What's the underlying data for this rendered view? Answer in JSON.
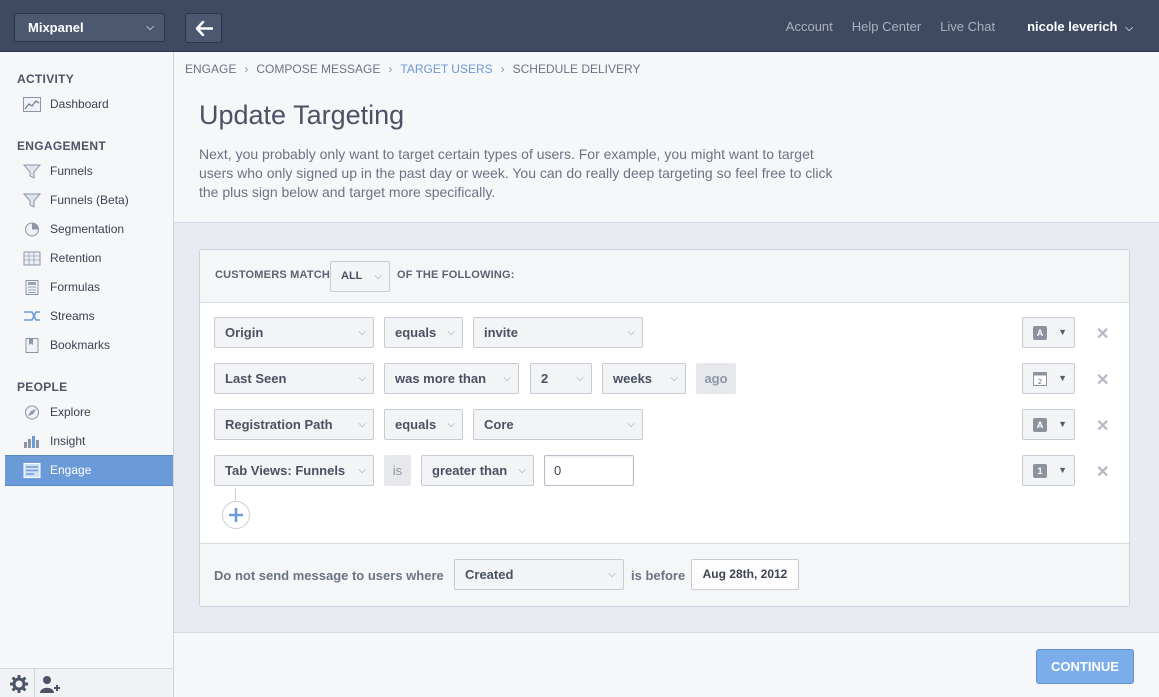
{
  "app": {
    "name": "Mixpanel"
  },
  "topbar": {
    "links": [
      "Account",
      "Help Center",
      "Live Chat"
    ],
    "user": "nicole leverich"
  },
  "sidebar": {
    "sections": [
      {
        "title": "ACTIVITY",
        "items": [
          {
            "label": "Dashboard",
            "icon": "dashboard-icon"
          }
        ]
      },
      {
        "title": "ENGAGEMENT",
        "items": [
          {
            "label": "Funnels",
            "icon": "funnel-icon"
          },
          {
            "label": "Funnels (Beta)",
            "icon": "funnel-icon"
          },
          {
            "label": "Segmentation",
            "icon": "pie-chart-icon"
          },
          {
            "label": "Retention",
            "icon": "retention-grid-icon"
          },
          {
            "label": "Formulas",
            "icon": "calculator-icon"
          },
          {
            "label": "Streams",
            "icon": "streams-icon"
          },
          {
            "label": "Bookmarks",
            "icon": "bookmark-icon"
          }
        ]
      },
      {
        "title": "PEOPLE",
        "items": [
          {
            "label": "Explore",
            "icon": "compass-icon"
          },
          {
            "label": "Insight",
            "icon": "bar-chart-icon"
          },
          {
            "label": "Engage",
            "icon": "engage-icon",
            "active": true
          }
        ]
      }
    ]
  },
  "breadcrumb": [
    "ENGAGE",
    "COMPOSE MESSAGE",
    "TARGET USERS",
    "SCHEDULE DELIVERY"
  ],
  "breadcrumb_current": 2,
  "page": {
    "title": "Update Targeting",
    "description": "Next, you probably only want to target certain types of users. For example, you might want to target users who only signed up in the past day or week. You can do really deep targeting so feel free to click the plus sign below and target more specifically."
  },
  "targeting": {
    "match_prefix": "CUSTOMERS MATCH",
    "match_value": "ALL",
    "match_suffix": "OF THE FOLLOWING:",
    "rules": [
      {
        "property": "Origin",
        "operator": "equals",
        "value": "invite",
        "type_badge": "A"
      },
      {
        "property": "Last Seen",
        "operator": "was more than",
        "value": "2",
        "unit": "weeks",
        "suffix": "ago",
        "type_badge": "calendar"
      },
      {
        "property": "Registration Path",
        "operator": "equals",
        "value": "Core",
        "type_badge": "A"
      },
      {
        "property": "Tab Views: Funnels",
        "connector": "is",
        "operator": "greater than",
        "value": "0",
        "type_badge": "1"
      }
    ],
    "exclusion": {
      "prefix": "Do not send message to users where",
      "property": "Created",
      "middle": "is before",
      "date": "Aug 28th, 2012"
    }
  },
  "actions": {
    "continue_label": "CONTINUE"
  },
  "colors": {
    "topbar": "#3f4a61",
    "accent": "#6a9bd8",
    "continue": "#7aade9"
  }
}
